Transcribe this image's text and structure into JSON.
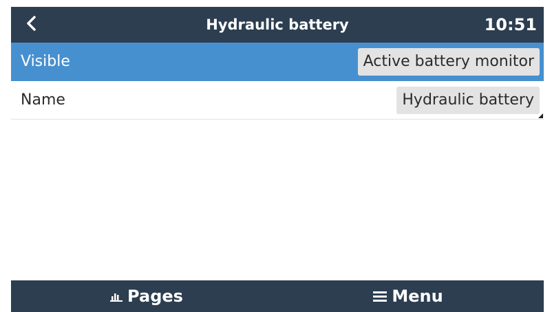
{
  "header": {
    "back_icon": "chevron-left-icon",
    "title": "Hydraulic battery",
    "time": "10:51"
  },
  "rows": [
    {
      "label": "Visible",
      "value": "Active battery monitor",
      "selected": true
    },
    {
      "label": "Name",
      "value": "Hydraulic battery",
      "editable": true
    }
  ],
  "footer": {
    "pages_label": "Pages",
    "pages_icon": "bar-chart-icon",
    "menu_label": "Menu",
    "menu_icon": "hamburger-menu-icon"
  },
  "colors": {
    "header_bg": "#2c3e50",
    "selected_row_bg": "#4790d0",
    "value_box_bg": "#e3e3e3"
  }
}
